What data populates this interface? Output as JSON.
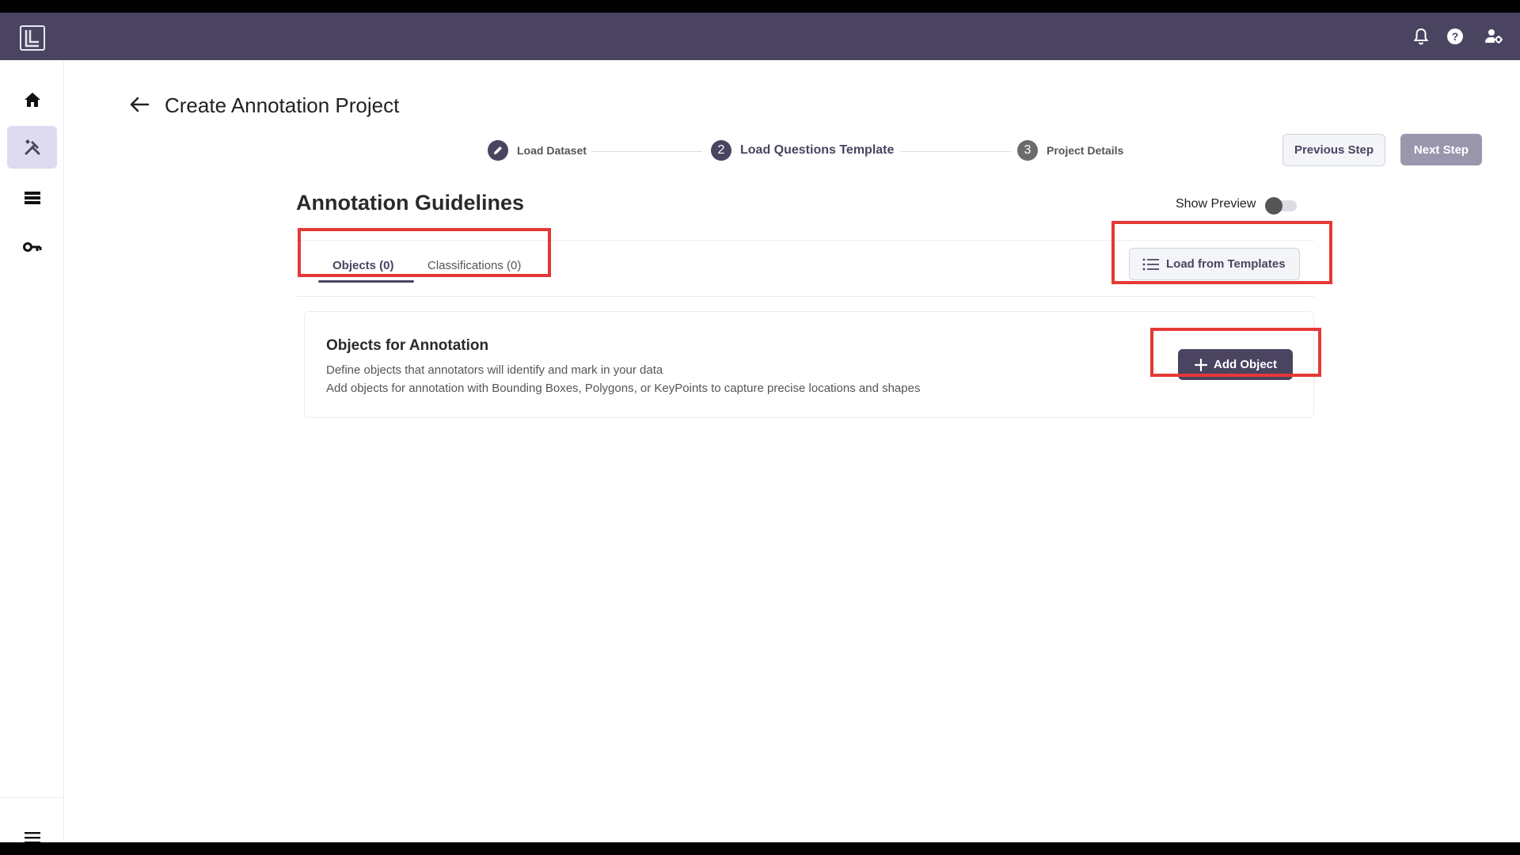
{
  "header": {
    "title": "Create Annotation Project",
    "previous_label": "Previous Step",
    "next_label": "Next Step"
  },
  "stepper": {
    "steps": [
      {
        "label": "Load Dataset",
        "marker": "edit-icon",
        "state": "completed"
      },
      {
        "label": "Load Questions Template",
        "marker": "2",
        "state": "current"
      },
      {
        "label": "Project Details",
        "marker": "3",
        "state": "upcoming"
      }
    ]
  },
  "guidelines": {
    "title": "Annotation Guidelines",
    "preview_label": "Show Preview",
    "preview_on": false,
    "tabs": [
      {
        "label": "Objects (0)",
        "active": true
      },
      {
        "label": "Classifications (0)",
        "active": false
      }
    ],
    "load_templates_label": "Load from Templates"
  },
  "objects_card": {
    "title": "Objects for Annotation",
    "description_1": "Define objects that annotators will identify and mark in your data",
    "description_2": "Add objects for annotation with Bounding Boxes, Polygons, or KeyPoints to capture precise locations and shapes",
    "add_label": "Add Object"
  },
  "topbar": {
    "icons": [
      "bell-icon",
      "help-icon",
      "user-settings-icon"
    ]
  },
  "sidebar": {
    "items": [
      "home-icon",
      "tools-icon",
      "list-icon",
      "key-icon"
    ],
    "active": "tools-icon",
    "bottom": "menu-icon"
  },
  "colors": {
    "brand": "#4a4461",
    "highlight": "#e53935",
    "disabled_button": "#9a97ad",
    "active_nav": "#dedbf0"
  }
}
